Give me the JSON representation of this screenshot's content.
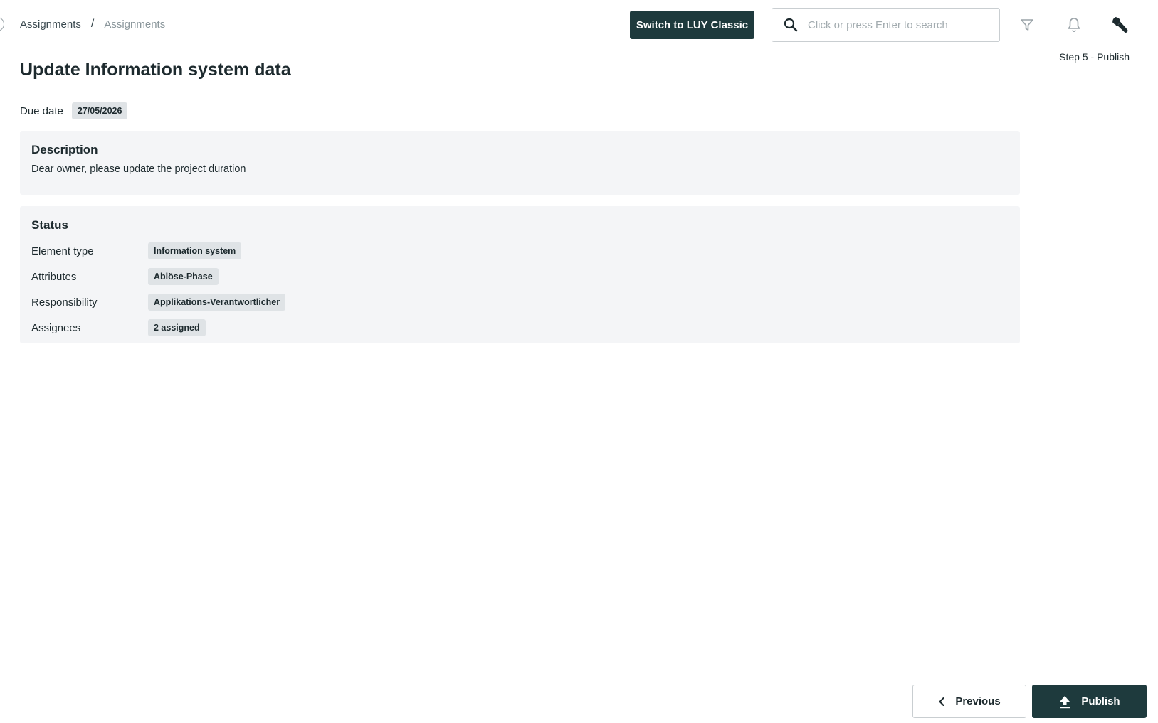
{
  "breadcrumb": {
    "items": [
      "Assignments",
      "Assignments"
    ],
    "separator": "/"
  },
  "header": {
    "switch_label": "Switch to LUY Classic",
    "search_placeholder": "Click or press Enter to search",
    "search_value": "",
    "icons": [
      "search-icon",
      "filter-icon",
      "bell-icon",
      "wrench-icon"
    ]
  },
  "step_label": "Step 5 - Publish",
  "page_title": "Update Information system data",
  "due": {
    "label": "Due date",
    "value": "27/05/2026"
  },
  "description": {
    "title": "Description",
    "text": "Dear owner, please update the project duration"
  },
  "status": {
    "title": "Status",
    "rows": [
      {
        "key": "Element type",
        "value": "Information system"
      },
      {
        "key": "Attributes",
        "value": "Ablöse-Phase"
      },
      {
        "key": "Responsibility",
        "value": "Applikations-Verantwortlicher"
      },
      {
        "key": "Assignees",
        "value": "2 assigned"
      }
    ]
  },
  "footer": {
    "previous_label": "Previous",
    "publish_label": "Publish"
  },
  "colors": {
    "primary": "#1e3a3d",
    "panel_bg": "#f4f5f7",
    "tag_bg": "#dfe3e6"
  }
}
